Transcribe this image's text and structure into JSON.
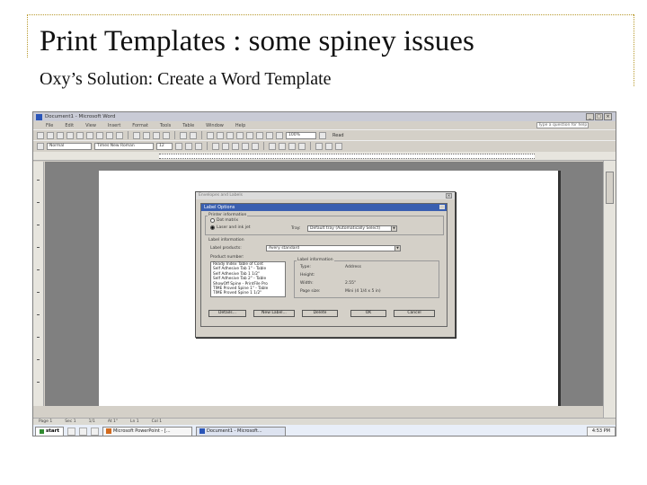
{
  "slide": {
    "title": "Print Templates : some spiney issues",
    "subtitle": "Oxy’s Solution: Create a Word Template"
  },
  "word": {
    "window_title": "Document1 - Microsoft Word",
    "menu": [
      "File",
      "Edit",
      "View",
      "Insert",
      "Format",
      "Tools",
      "Table",
      "Window",
      "Help"
    ],
    "help_placeholder": "Type a question for help",
    "zoom": "100%",
    "read_label": "Read",
    "style": "Normal",
    "font": "Times New Roman",
    "font_size": "12",
    "status": [
      "Page 1",
      "Sec 1",
      "1/1",
      "At 1\"",
      "Ln 1",
      "Col 1"
    ]
  },
  "dialog": {
    "outer_title": "Envelopes and Labels",
    "title": "Label Options",
    "printer_info_label": "Printer information",
    "dot_matrix": "Dot matrix",
    "laser_inkjet": "Laser and ink jet",
    "tray_label": "Tray:",
    "tray_value": "Default tray (Automatically Select)",
    "label_info_label": "Label information",
    "label_products_label": "Label products:",
    "label_products_value": "Avery standard",
    "product_number_label": "Product number:",
    "product_list": [
      "Ready Index Table of Cont",
      "Self Adhesive Tab 1\" - Table",
      "Self Adhesive Tab 1 1/2\"",
      "Self Adhesive Tab 2\" - Table",
      "ShowOff Spine - PrintFile Pro",
      "TIME Proved Spine 1\" - Table",
      "TIME Proved Spine 1 1/2\""
    ],
    "info_group_label": "Label information",
    "info": [
      {
        "label": "Type:",
        "value": "Address"
      },
      {
        "label": "Height:",
        "value": ""
      },
      {
        "label": "Width:",
        "value": "2.55\""
      },
      {
        "label": "Page size:",
        "value": "Mini (4 1/4 x 5 in)"
      }
    ],
    "buttons": {
      "details": "Details...",
      "new_label": "New Label...",
      "delete": "Delete",
      "ok": "OK",
      "cancel": "Cancel"
    }
  },
  "taskbar": {
    "start": "start",
    "tasks": [
      "Microsoft PowerPoint - [...",
      "Document1 - Microsoft..."
    ],
    "clock": "4:53 PM"
  }
}
